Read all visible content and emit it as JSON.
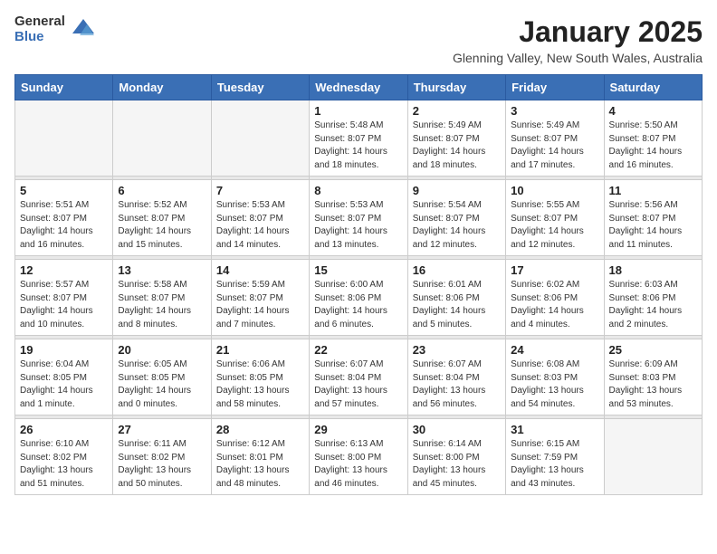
{
  "header": {
    "logo_general": "General",
    "logo_blue": "Blue",
    "title": "January 2025",
    "subtitle": "Glenning Valley, New South Wales, Australia"
  },
  "days_of_week": [
    "Sunday",
    "Monday",
    "Tuesday",
    "Wednesday",
    "Thursday",
    "Friday",
    "Saturday"
  ],
  "weeks": [
    [
      {
        "day": "",
        "info": ""
      },
      {
        "day": "",
        "info": ""
      },
      {
        "day": "",
        "info": ""
      },
      {
        "day": "1",
        "info": "Sunrise: 5:48 AM\nSunset: 8:07 PM\nDaylight: 14 hours\nand 18 minutes."
      },
      {
        "day": "2",
        "info": "Sunrise: 5:49 AM\nSunset: 8:07 PM\nDaylight: 14 hours\nand 18 minutes."
      },
      {
        "day": "3",
        "info": "Sunrise: 5:49 AM\nSunset: 8:07 PM\nDaylight: 14 hours\nand 17 minutes."
      },
      {
        "day": "4",
        "info": "Sunrise: 5:50 AM\nSunset: 8:07 PM\nDaylight: 14 hours\nand 16 minutes."
      }
    ],
    [
      {
        "day": "5",
        "info": "Sunrise: 5:51 AM\nSunset: 8:07 PM\nDaylight: 14 hours\nand 16 minutes."
      },
      {
        "day": "6",
        "info": "Sunrise: 5:52 AM\nSunset: 8:07 PM\nDaylight: 14 hours\nand 15 minutes."
      },
      {
        "day": "7",
        "info": "Sunrise: 5:53 AM\nSunset: 8:07 PM\nDaylight: 14 hours\nand 14 minutes."
      },
      {
        "day": "8",
        "info": "Sunrise: 5:53 AM\nSunset: 8:07 PM\nDaylight: 14 hours\nand 13 minutes."
      },
      {
        "day": "9",
        "info": "Sunrise: 5:54 AM\nSunset: 8:07 PM\nDaylight: 14 hours\nand 12 minutes."
      },
      {
        "day": "10",
        "info": "Sunrise: 5:55 AM\nSunset: 8:07 PM\nDaylight: 14 hours\nand 12 minutes."
      },
      {
        "day": "11",
        "info": "Sunrise: 5:56 AM\nSunset: 8:07 PM\nDaylight: 14 hours\nand 11 minutes."
      }
    ],
    [
      {
        "day": "12",
        "info": "Sunrise: 5:57 AM\nSunset: 8:07 PM\nDaylight: 14 hours\nand 10 minutes."
      },
      {
        "day": "13",
        "info": "Sunrise: 5:58 AM\nSunset: 8:07 PM\nDaylight: 14 hours\nand 8 minutes."
      },
      {
        "day": "14",
        "info": "Sunrise: 5:59 AM\nSunset: 8:07 PM\nDaylight: 14 hours\nand 7 minutes."
      },
      {
        "day": "15",
        "info": "Sunrise: 6:00 AM\nSunset: 8:06 PM\nDaylight: 14 hours\nand 6 minutes."
      },
      {
        "day": "16",
        "info": "Sunrise: 6:01 AM\nSunset: 8:06 PM\nDaylight: 14 hours\nand 5 minutes."
      },
      {
        "day": "17",
        "info": "Sunrise: 6:02 AM\nSunset: 8:06 PM\nDaylight: 14 hours\nand 4 minutes."
      },
      {
        "day": "18",
        "info": "Sunrise: 6:03 AM\nSunset: 8:06 PM\nDaylight: 14 hours\nand 2 minutes."
      }
    ],
    [
      {
        "day": "19",
        "info": "Sunrise: 6:04 AM\nSunset: 8:05 PM\nDaylight: 14 hours\nand 1 minute."
      },
      {
        "day": "20",
        "info": "Sunrise: 6:05 AM\nSunset: 8:05 PM\nDaylight: 14 hours\nand 0 minutes."
      },
      {
        "day": "21",
        "info": "Sunrise: 6:06 AM\nSunset: 8:05 PM\nDaylight: 13 hours\nand 58 minutes."
      },
      {
        "day": "22",
        "info": "Sunrise: 6:07 AM\nSunset: 8:04 PM\nDaylight: 13 hours\nand 57 minutes."
      },
      {
        "day": "23",
        "info": "Sunrise: 6:07 AM\nSunset: 8:04 PM\nDaylight: 13 hours\nand 56 minutes."
      },
      {
        "day": "24",
        "info": "Sunrise: 6:08 AM\nSunset: 8:03 PM\nDaylight: 13 hours\nand 54 minutes."
      },
      {
        "day": "25",
        "info": "Sunrise: 6:09 AM\nSunset: 8:03 PM\nDaylight: 13 hours\nand 53 minutes."
      }
    ],
    [
      {
        "day": "26",
        "info": "Sunrise: 6:10 AM\nSunset: 8:02 PM\nDaylight: 13 hours\nand 51 minutes."
      },
      {
        "day": "27",
        "info": "Sunrise: 6:11 AM\nSunset: 8:02 PM\nDaylight: 13 hours\nand 50 minutes."
      },
      {
        "day": "28",
        "info": "Sunrise: 6:12 AM\nSunset: 8:01 PM\nDaylight: 13 hours\nand 48 minutes."
      },
      {
        "day": "29",
        "info": "Sunrise: 6:13 AM\nSunset: 8:00 PM\nDaylight: 13 hours\nand 46 minutes."
      },
      {
        "day": "30",
        "info": "Sunrise: 6:14 AM\nSunset: 8:00 PM\nDaylight: 13 hours\nand 45 minutes."
      },
      {
        "day": "31",
        "info": "Sunrise: 6:15 AM\nSunset: 7:59 PM\nDaylight: 13 hours\nand 43 minutes."
      },
      {
        "day": "",
        "info": ""
      }
    ]
  ]
}
